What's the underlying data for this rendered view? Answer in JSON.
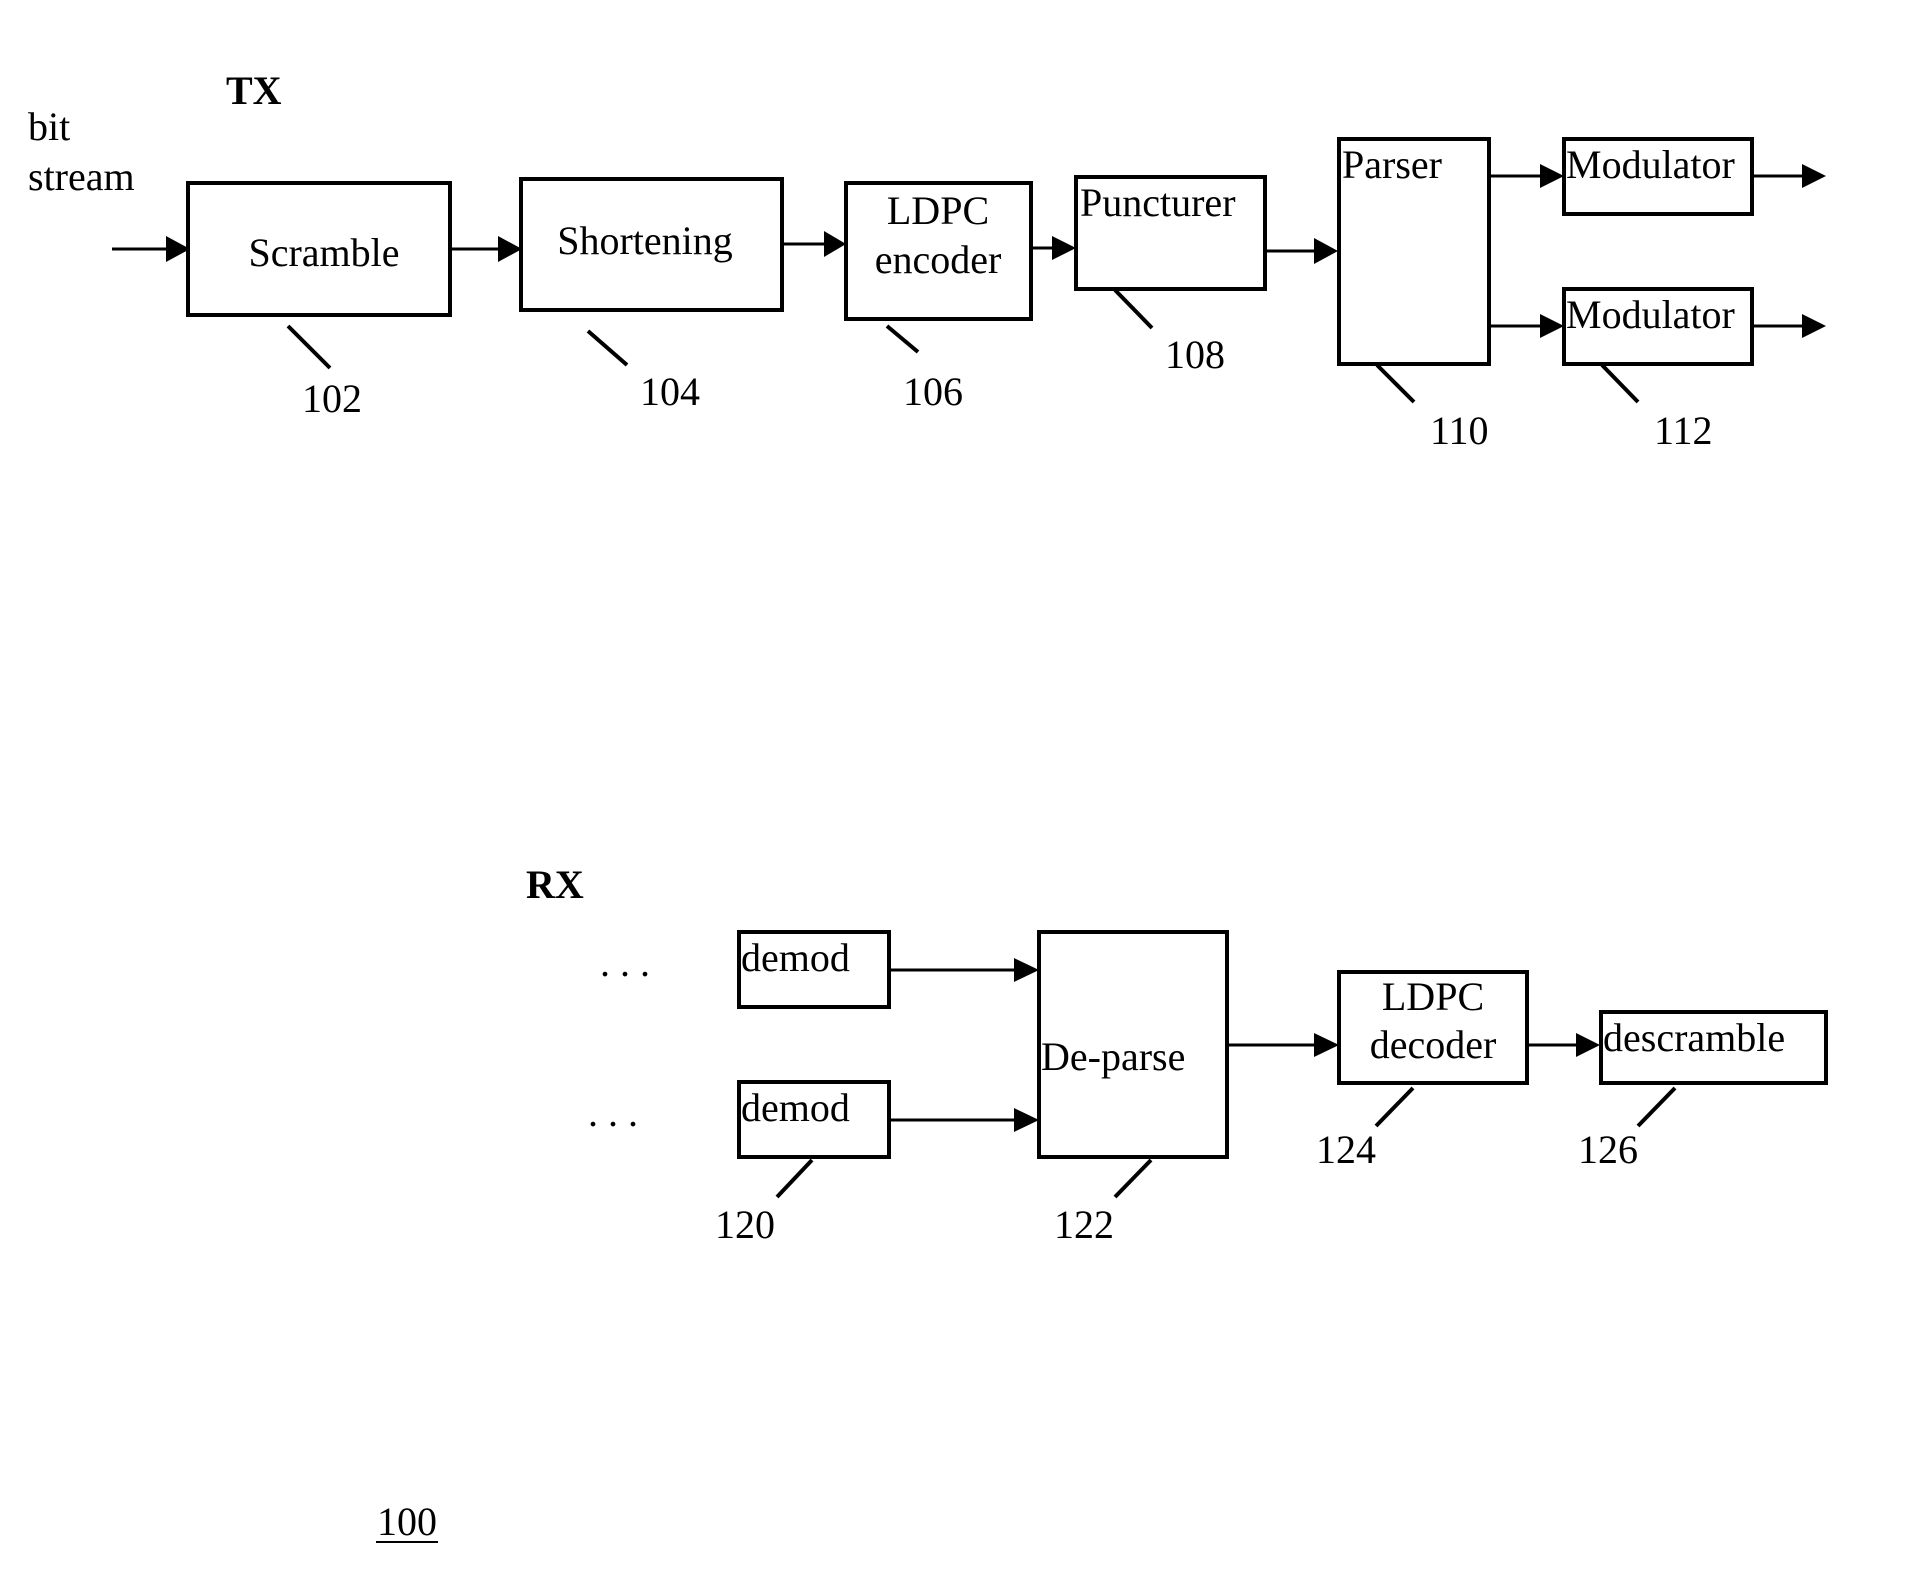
{
  "figure": {
    "tx_title": "TX",
    "rx_title": "RX",
    "input_label_line1": "bit",
    "input_label_line2": "stream",
    "figure_number": "100",
    "ellipsis": ". . ."
  },
  "tx_blocks": [
    {
      "id": "scramble",
      "lines": [
        "Scramble"
      ],
      "ref": "102"
    },
    {
      "id": "shortening",
      "lines": [
        "Shortening"
      ],
      "ref": "104"
    },
    {
      "id": "ldpc-encoder",
      "lines": [
        "LDPC",
        "encoder"
      ],
      "ref": "106"
    },
    {
      "id": "puncturer",
      "lines": [
        "Puncturer"
      ],
      "ref": "108"
    },
    {
      "id": "parser",
      "lines": [
        "Parser"
      ],
      "ref": "110"
    },
    {
      "id": "modulator-1",
      "lines": [
        "Modulator"
      ],
      "ref": ""
    },
    {
      "id": "modulator-2",
      "lines": [
        "Modulator"
      ],
      "ref": "112"
    }
  ],
  "rx_blocks": [
    {
      "id": "demod-1",
      "lines": [
        "demod"
      ],
      "ref": ""
    },
    {
      "id": "demod-2",
      "lines": [
        "demod"
      ],
      "ref": "120"
    },
    {
      "id": "de-parse",
      "lines": [
        "De-parse"
      ],
      "ref": "122"
    },
    {
      "id": "ldpc-decoder",
      "lines": [
        "LDPC",
        "decoder"
      ],
      "ref": "124"
    },
    {
      "id": "descramble",
      "lines": [
        "descramble"
      ],
      "ref": "126"
    }
  ]
}
